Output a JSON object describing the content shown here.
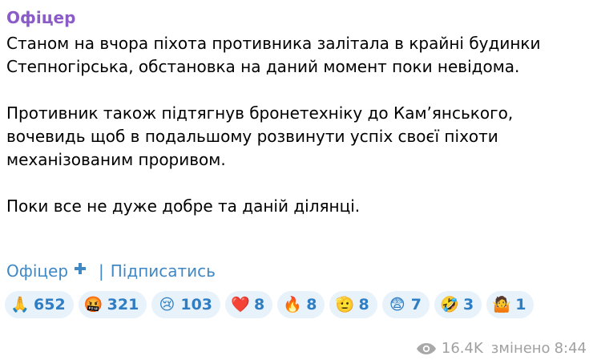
{
  "channel": {
    "name": "Офіцер"
  },
  "message": {
    "paragraphs": [
      "Станом на вчора піхота противника залітала в крайні будинки Степногірська, обстановка на даний момент поки невідома.",
      "Противник також підтягнув бронетехніку до Кам’янського, вочевидь щоб в подальшому розвинути успіх своєї піхоти механізованим проривом.",
      "Поки все не дуже добре та даній ділянці."
    ]
  },
  "signature": {
    "name": "Офіцер",
    "cross_icon": "blue-cross-icon",
    "separator": "|",
    "subscribe": "Підписатись"
  },
  "reactions": [
    {
      "emoji": "🙏",
      "icon": "folded-hands-icon",
      "count": "652"
    },
    {
      "emoji": "🤬",
      "icon": "cursing-face-icon",
      "count": "321"
    },
    {
      "emoji": "😢",
      "icon": "crying-face-icon",
      "count": "103"
    },
    {
      "emoji": "❤️",
      "icon": "red-heart-icon",
      "count": "8"
    },
    {
      "emoji": "🔥",
      "icon": "fire-icon",
      "count": "8"
    },
    {
      "emoji": "🫡",
      "icon": "saluting-hand-icon",
      "count": "8"
    },
    {
      "emoji": "😨",
      "icon": "fearful-face-icon",
      "count": "7"
    },
    {
      "emoji": "🤣",
      "icon": "rolling-laughing-icon",
      "count": "3"
    },
    {
      "emoji": "🤷",
      "icon": "shrug-icon",
      "count": "1"
    }
  ],
  "meta": {
    "views": "16.4K",
    "edited_label": "змінено",
    "time": "8:44"
  },
  "colors": {
    "channel_name": "#8b5cc7",
    "link": "#3f88c5",
    "reaction_bg": "#e8f2fb",
    "reaction_text": "#2f7ec4",
    "meta_text": "#a0a0a0"
  }
}
